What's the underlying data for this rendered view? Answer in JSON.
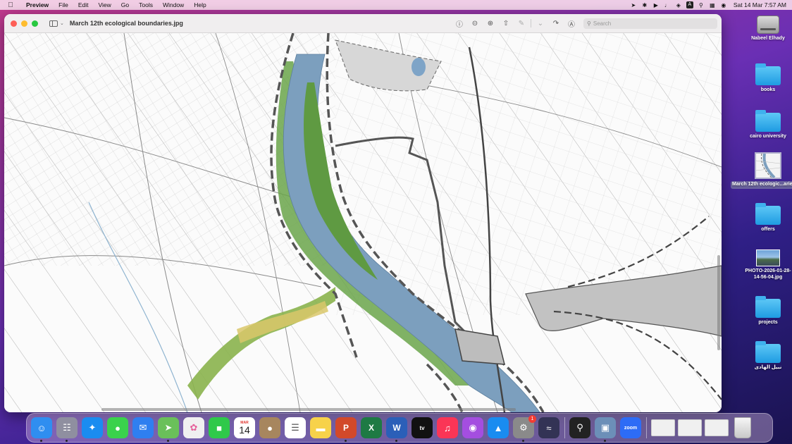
{
  "menubar": {
    "app_name": "Preview",
    "items": [
      "File",
      "Edit",
      "View",
      "Go",
      "Tools",
      "Window",
      "Help"
    ],
    "status_letter": "A",
    "clock": "Sat 14 Mar  7:57 AM"
  },
  "window": {
    "title": "March 12th ecological boundaries.jpg",
    "search_placeholder": "Search"
  },
  "desktop": {
    "items": [
      {
        "label": "Nabeel Elhady",
        "kind": "disk"
      },
      {
        "label": "books",
        "kind": "folder"
      },
      {
        "label": "cairo university",
        "kind": "folder"
      },
      {
        "label": "March 12th ecologic...aries.jpg",
        "kind": "image",
        "selected": true
      },
      {
        "label": "offers",
        "kind": "folder"
      },
      {
        "label": "PHOTO-2026-01-28-14-56-04.jpg",
        "kind": "photo"
      },
      {
        "label": "projects",
        "kind": "folder"
      },
      {
        "label": "نبيل الهادى",
        "kind": "folder"
      }
    ]
  },
  "dock": {
    "calendar_month": "MAR",
    "calendar_day": "14",
    "settings_badge": "1",
    "word_letter": "W",
    "excel_letter": "X",
    "powerpoint_letter": "P",
    "tv_label": "tv",
    "zoom_label": "zoom",
    "colors": {
      "finder": "#2f8ef0",
      "launchpad": "#8f8fa0",
      "safari": "#1a8cf0",
      "messages": "#3ad24c",
      "mail": "#2f7ff0",
      "maps": "#6ac05a",
      "photos": "#f0f0f0",
      "facetime": "#2fc94a",
      "calendar": "#ffffff",
      "contacts": "#a7865e",
      "reminders": "#ffffff",
      "notes": "#f7d24a",
      "powerpoint": "#d2492a",
      "excel": "#1e7a44",
      "word": "#2b5fb8",
      "tv": "#111111",
      "music": "#fa3556",
      "podcasts": "#a44ee0",
      "appstore": "#1a8cf0",
      "settings": "#8a8a8a",
      "siri": "#333355",
      "quicktime": "#222222",
      "preview": "#6c8fb8",
      "zoom": "#2d6cf6"
    }
  }
}
